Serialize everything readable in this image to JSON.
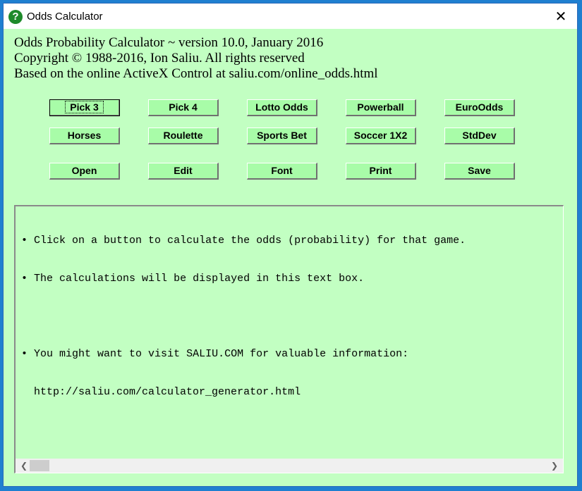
{
  "window": {
    "title": "Odds Calculator",
    "close_glyph": "✕",
    "app_icon_glyph": "?"
  },
  "header": {
    "line1": "Odds Probability Calculator ~ version 10.0, January 2016",
    "line2": "Copyright © 1988-2016, Ion Saliu. All rights reserved",
    "line3": "Based on the online ActiveX Control at saliu.com/online_odds.html"
  },
  "buttons": {
    "row1": [
      "Pick 3",
      "Pick 4",
      "Lotto Odds",
      "Powerball",
      "EuroOdds"
    ],
    "row2": [
      "Horses",
      "Roulette",
      "Sports Bet",
      "Soccer 1X2",
      "StdDev"
    ],
    "row3": [
      "Open",
      "Edit",
      "Font",
      "Print",
      "Save"
    ]
  },
  "textbox": {
    "bullet": "•",
    "lines": [
      "Click on a button to calculate the odds (probability) for that game.",
      "The calculations will be displayed in this text box.",
      "You might want to visit SALIU.COM for valuable information:",
      "http://saliu.com/calculator_generator.html"
    ]
  },
  "scrollbar": {
    "left_glyph": "❮",
    "right_glyph": "❯"
  },
  "colors": {
    "window_bg": "#c2ffc2",
    "button_bg": "#a8fca8",
    "desktop": "#1f7fd0"
  }
}
